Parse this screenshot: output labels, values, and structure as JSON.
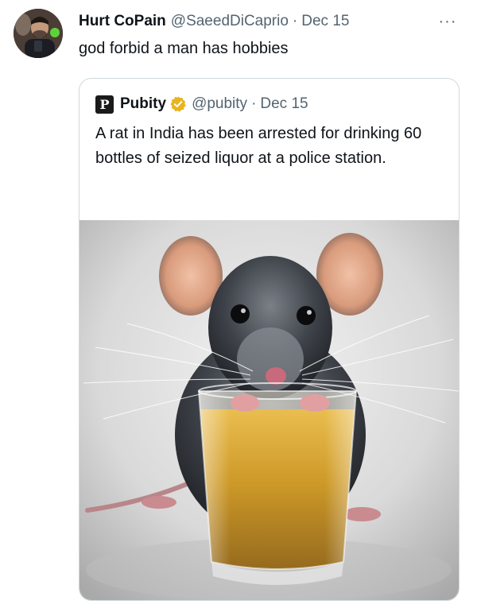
{
  "tweet": {
    "author_name": "Hurt CoPain",
    "author_handle": "@SaeedDiCaprio",
    "separator": "·",
    "date": "Dec 15",
    "more_icon": "···",
    "text": "god forbid a man has hobbies"
  },
  "quote": {
    "logo_letter": "P",
    "author_name": "Pubity",
    "author_handle": "@pubity",
    "separator": "·",
    "date": "Dec 15",
    "text": "A rat in India has been arrested for drinking 60 bottles of seized liquor at a police station.",
    "verified_color": "#e8b422"
  },
  "colors": {
    "text_primary": "#0f1419",
    "text_secondary": "#536471",
    "border": "#cfd9de"
  }
}
